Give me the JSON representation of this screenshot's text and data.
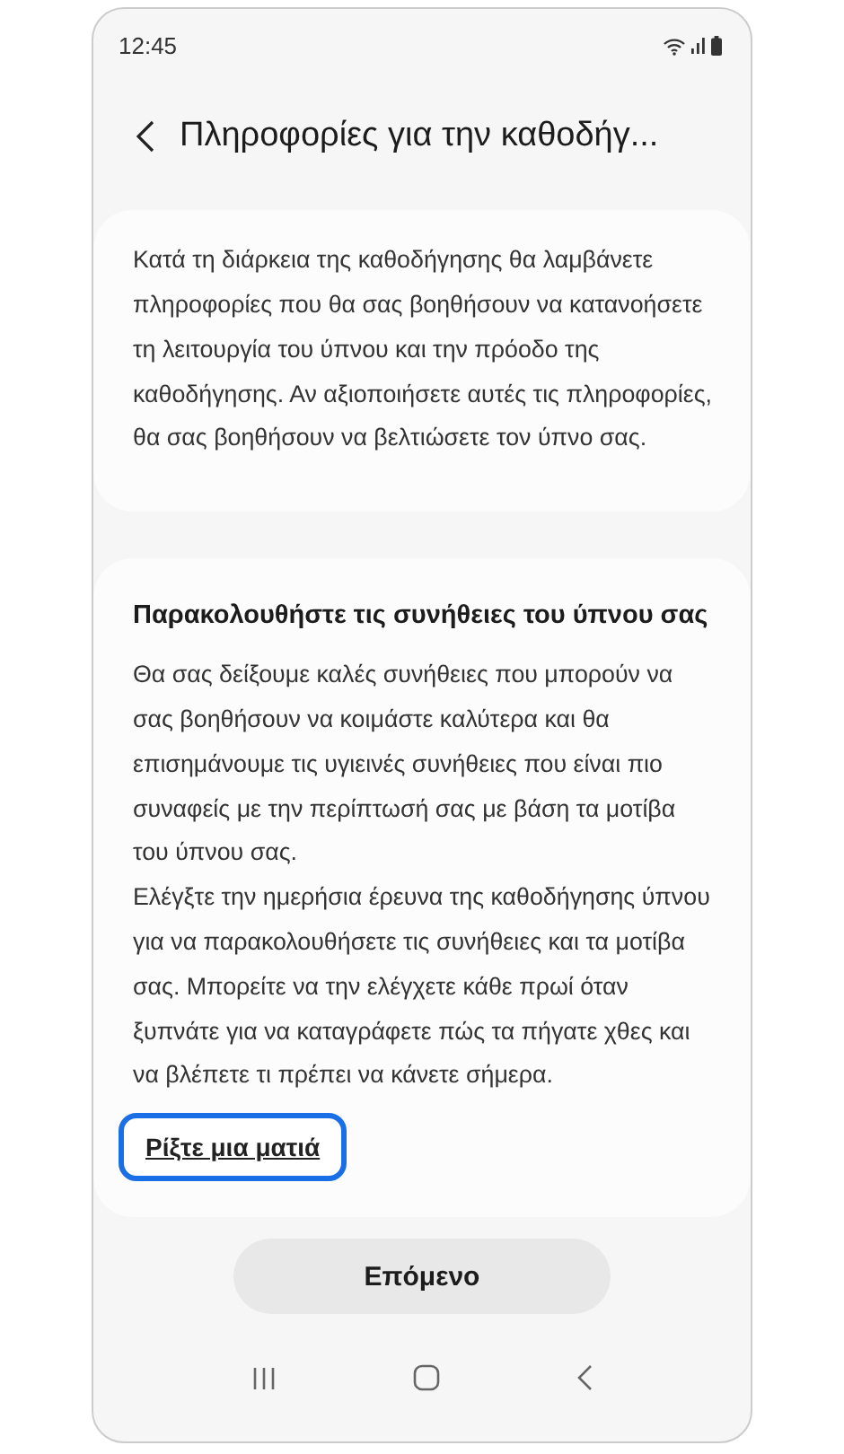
{
  "status_bar": {
    "time": "12:45"
  },
  "header": {
    "title": "Πληροφορίες για την καθοδήγ..."
  },
  "cards": [
    {
      "paragraphs": [
        "Κατά τη διάρκεια της καθοδήγησης θα λαμβάνετε πληροφορίες που θα σας βοηθήσουν να κατανοήσετε τη λειτουργία του ύπνου και την πρόοδο της καθοδήγησης. Αν αξιοποιήσετε αυτές τις πληροφορίες, θα σας βοηθήσουν να βελτιώσετε τον ύπνο σας."
      ]
    },
    {
      "title": "Παρακολουθήστε τις συνήθειες του ύπνου σας",
      "paragraphs": [
        "Θα σας δείξουμε καλές συνήθειες που μπορούν να σας βοηθήσουν να κοιμάστε καλύτερα και θα επισημάνουμε τις υγιεινές συνήθειες που είναι πιο συναφείς με την περίπτωσή σας με βάση τα μοτίβα του ύπνου σας.",
        "Ελέγξτε την ημερήσια έρευνα της καθοδήγησης ύπνου για να παρακολουθήσετε τις συνήθειες και τα μοτίβα σας. Μπορείτε να την ελέγχετε κάθε πρωί όταν ξυπνάτε για να καταγράφετε πώς τα πήγατε χθες και να βλέπετε τι πρέπει να κάνετε σήμερα."
      ],
      "link": {
        "label": "Ρίξτε μια ματιά",
        "focused": true
      }
    }
  ],
  "next_button": {
    "label": "Επόμενο"
  }
}
